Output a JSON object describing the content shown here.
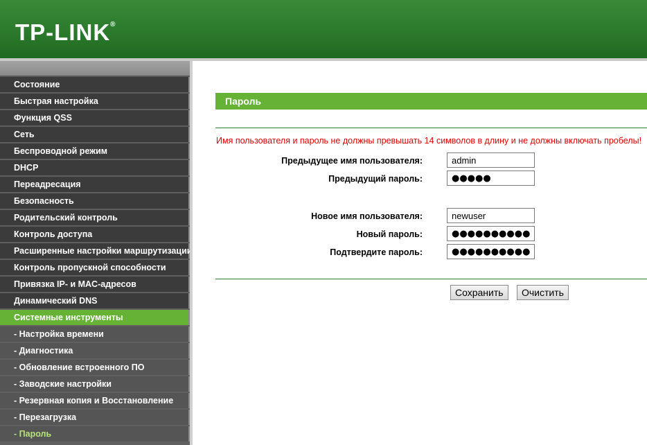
{
  "header": {
    "logo_text": "TP-LINK",
    "logo_mark": "®"
  },
  "sidebar": {
    "items": [
      {
        "label": "Состояние"
      },
      {
        "label": "Быстрая настройка"
      },
      {
        "label": "Функция QSS"
      },
      {
        "label": "Сеть"
      },
      {
        "label": "Беспроводной режим"
      },
      {
        "label": "DHCP"
      },
      {
        "label": "Переадресация"
      },
      {
        "label": "Безопасность"
      },
      {
        "label": "Родительский контроль"
      },
      {
        "label": "Контроль доступа"
      },
      {
        "label": "Расширенные настройки маршрутизации"
      },
      {
        "label": "Контроль пропускной способности"
      },
      {
        "label": "Привязка IP- и MAC-адресов"
      },
      {
        "label": "Динамический DNS"
      },
      {
        "label": "Системные инструменты"
      },
      {
        "label": "- Настройка времени"
      },
      {
        "label": "- Диагностика"
      },
      {
        "label": "- Обновление встроенного ПО"
      },
      {
        "label": "- Заводские настройки"
      },
      {
        "label": "- Резервная копия и Восстановление"
      },
      {
        "label": "- Перезагрузка"
      },
      {
        "label": "- Пароль"
      }
    ],
    "active_section": "Системные инструменты",
    "current_page": "- Пароль"
  },
  "main": {
    "title": "Пароль",
    "warning": "Имя пользователя и пароль не должны превышать 14 символов в длину и не должны включать пробелы!",
    "fields": {
      "old_username": {
        "label": "Предыдущее имя пользователя:",
        "value": "admin"
      },
      "old_password": {
        "label": "Предыдущий пароль:",
        "value": "●●●●●"
      },
      "new_username": {
        "label": "Новое имя пользователя:",
        "value": "newuser"
      },
      "new_password": {
        "label": "Новый пароль:",
        "value": "●●●●●●●●●●"
      },
      "confirm_password": {
        "label": "Подтвердите пароль:",
        "value": "●●●●●●●●●●"
      }
    },
    "buttons": {
      "save": "Сохранить",
      "clear": "Очистить"
    }
  },
  "colors": {
    "header_green": "#2e7d2e",
    "accent_green": "#66b235",
    "warning_red": "#e00000",
    "nav_dark": "#3b3b3b"
  }
}
